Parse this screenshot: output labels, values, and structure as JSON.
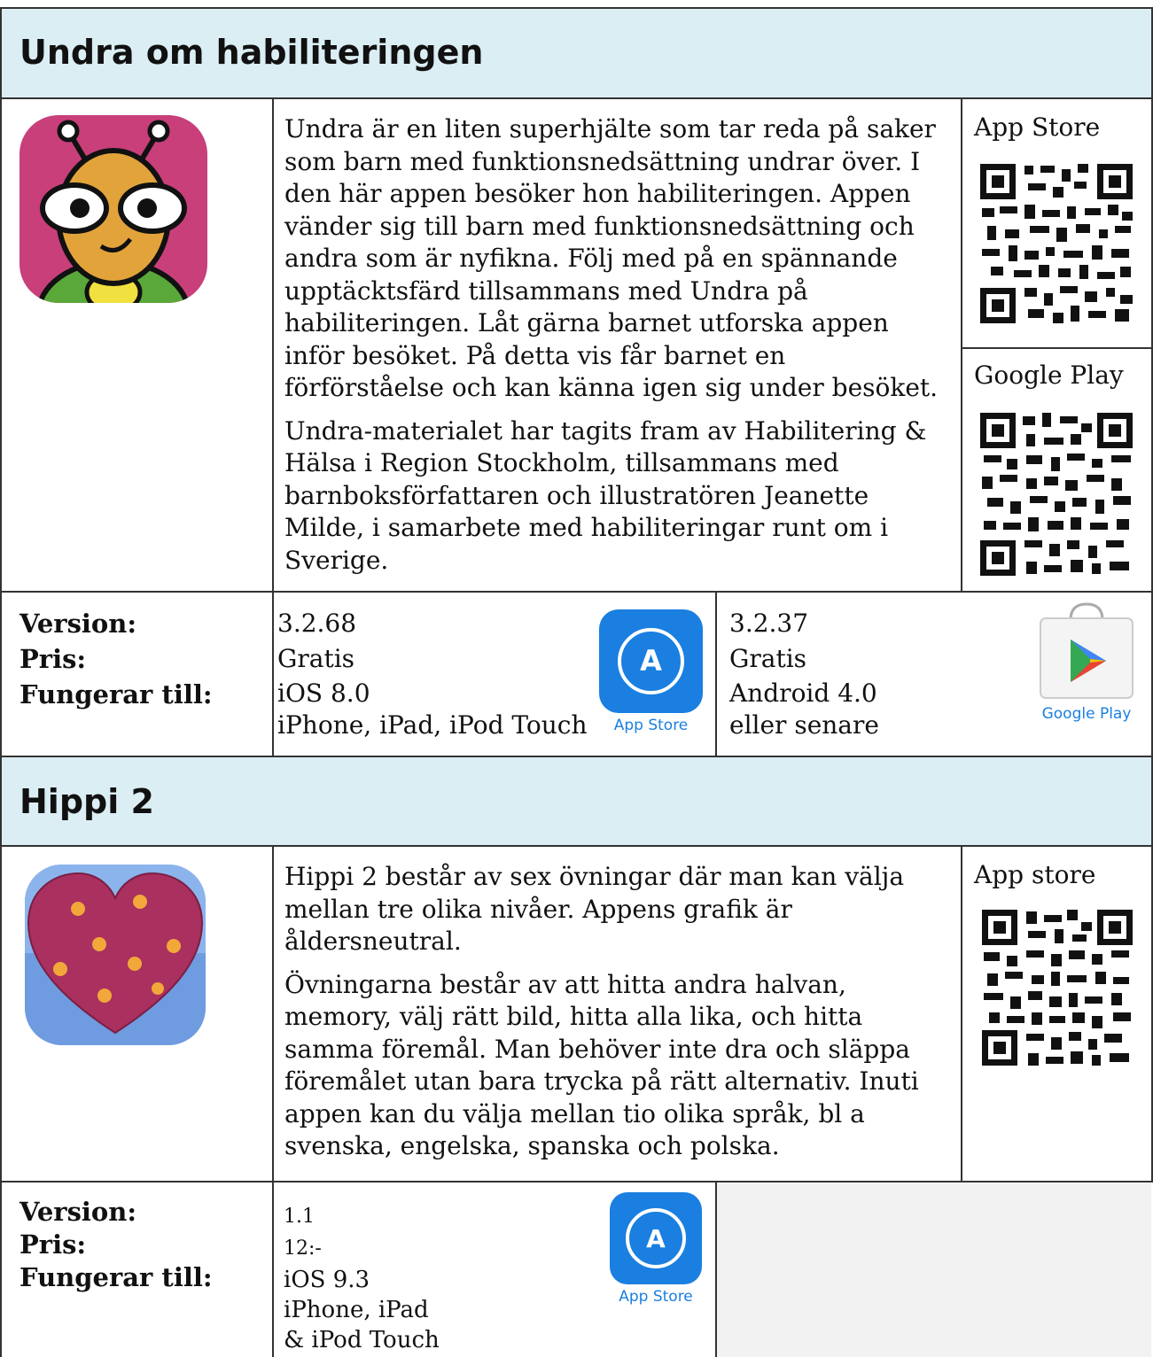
{
  "apps": [
    {
      "title": "Undra om habiliteringen",
      "icon": "undra-bee-icon",
      "description": [
        "Undra är en liten superhjälte som tar reda på saker som barn med funktionsnedsättning undrar över. I den här appen besöker hon habiliteringen. Appen vänder sig till barn med funktionsnedsättning och andra som är nyfikna. Följ med på en spännande upptäcktsfärd tillsammans med Undra på habiliteringen. Låt gärna barnet utforska appen inför besöket. På detta vis får barnet en förförståelse och kan känna igen sig under besöket.",
        "Undra-materialet har tagits fram av Habilitering & Hälsa i Region Stockholm, tillsammans med barnboksförfattaren och illustratören Jeanette Milde, i samarbete med habiliteringar runt om i Sverige."
      ],
      "qr_labels": [
        "App Store",
        "Google Play"
      ],
      "labels": [
        "Version:",
        "Pris:",
        "Fungerar till:"
      ],
      "ios": {
        "version": "3.2.68",
        "price": "Gratis",
        "os": "iOS 8.0",
        "devices": "iPhone, iPad, iPod Touch",
        "store": "App Store"
      },
      "android": {
        "version": "3.2.37",
        "price": "Gratis",
        "os": "Android 4.0",
        "note": "eller senare",
        "store": "Google Play"
      }
    },
    {
      "title": "Hippi 2",
      "icon": "heart-icon",
      "description": [
        "Hippi 2 består av sex övningar där man kan välja mellan tre olika nivåer. Appens grafik är åldersneutral.",
        "Övningarna består av att hitta andra halvan, memory, välj rätt bild, hitta alla lika, och hitta samma föremål. Man behöver inte dra och släppa föremålet utan bara trycka på rätt alternativ. Inuti appen kan du välja mellan tio olika språk, bl a svenska, engelska, spanska och polska."
      ],
      "qr_labels": [
        "App store"
      ],
      "labels": [
        "Version:",
        "Pris:",
        "Fungerar till:"
      ],
      "ios": {
        "version": "1.1",
        "price": "12:-",
        "os": "iOS 9.3",
        "devices": "iPhone, iPad",
        "devices2": "& iPod Touch",
        "store": "App Store"
      }
    }
  ]
}
